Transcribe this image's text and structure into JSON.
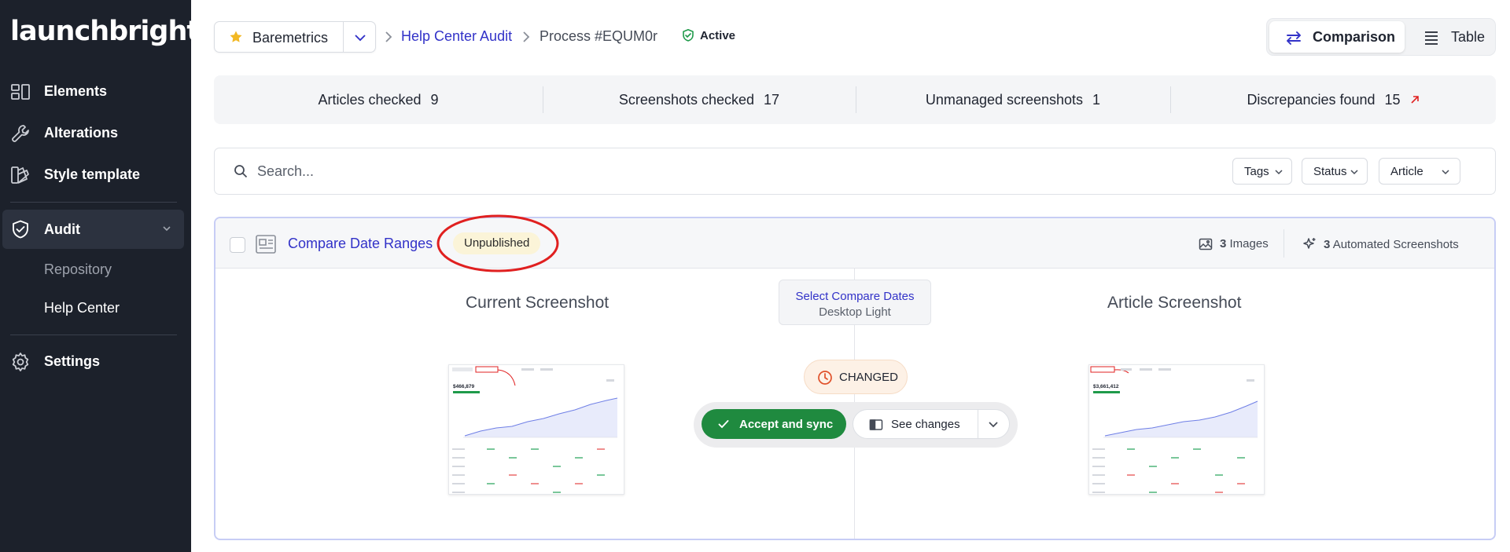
{
  "sidebar": {
    "logo": "launchbrightly",
    "items": [
      {
        "label": "Elements",
        "icon": "elements-icon"
      },
      {
        "label": "Alterations",
        "icon": "wrench-icon"
      },
      {
        "label": "Style template",
        "icon": "style-template-icon"
      },
      {
        "label": "Audit",
        "icon": "shield-check-icon"
      }
    ],
    "sub_items": [
      {
        "label": "Repository"
      },
      {
        "label": "Help Center"
      }
    ],
    "settings": {
      "label": "Settings",
      "icon": "gear-icon"
    }
  },
  "header": {
    "workspace": "Baremetrics",
    "breadcrumb": {
      "audit": "Help Center Audit",
      "process": "Process #EQUM0r"
    },
    "status": "Active",
    "views": {
      "comparison": "Comparison",
      "table": "Table"
    }
  },
  "stats": [
    {
      "label": "Articles checked",
      "value": "9"
    },
    {
      "label": "Screenshots checked",
      "value": "17"
    },
    {
      "label": "Unmanaged screenshots",
      "value": "1"
    },
    {
      "label": "Discrepancies found",
      "value": "15"
    }
  ],
  "filters": {
    "search_placeholder": "Search...",
    "tags": "Tags",
    "status": "Status",
    "article": "Article"
  },
  "article": {
    "title": "Compare Date Ranges",
    "badge": "Unpublished",
    "images": "3",
    "images_label": "Images",
    "automated": "3",
    "automated_label": "Automated Screenshots",
    "current_title": "Current Screenshot",
    "article_title": "Article Screenshot",
    "context_name": "Select Compare Dates",
    "context_theme": "Desktop Light",
    "state": "CHANGED",
    "accept_label": "Accept and sync",
    "see_changes_label": "See changes",
    "current_value": "$466,879",
    "article_value": "$3,661,412"
  },
  "colors": {
    "sidebar_bg": "#1c212b",
    "link": "#3232c8",
    "accept": "#1f8a3f",
    "annotation_ring": "#e02020"
  }
}
